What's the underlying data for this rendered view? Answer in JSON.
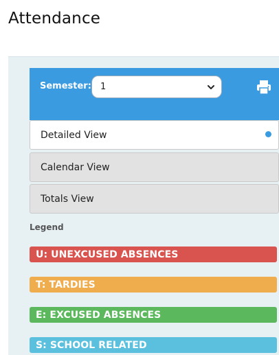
{
  "page": {
    "title": "Attendance"
  },
  "semester": {
    "label": "Semester:",
    "selected": "1"
  },
  "views": [
    {
      "label": "Detailed View",
      "active": true
    },
    {
      "label": "Calendar View",
      "active": false
    },
    {
      "label": "Totals View",
      "active": false
    }
  ],
  "legend": {
    "heading": "Legend",
    "items": [
      {
        "label": "U: UNEXCUSED ABSENCES",
        "color": "#d9534f"
      },
      {
        "label": "T: TARDIES",
        "color": "#f0ad4e"
      },
      {
        "label": "E: EXCUSED ABSENCES",
        "color": "#5cb85c"
      },
      {
        "label": "S: SCHOOL RELATED",
        "color": "#5bc0de"
      }
    ]
  },
  "colors": {
    "accent": "#3a9be0",
    "panel_bg": "#e7f1f4",
    "inactive_tab": "#e2e2e2"
  },
  "icons": {
    "print": "printer-icon",
    "dropdown": "chevron-down-icon"
  }
}
